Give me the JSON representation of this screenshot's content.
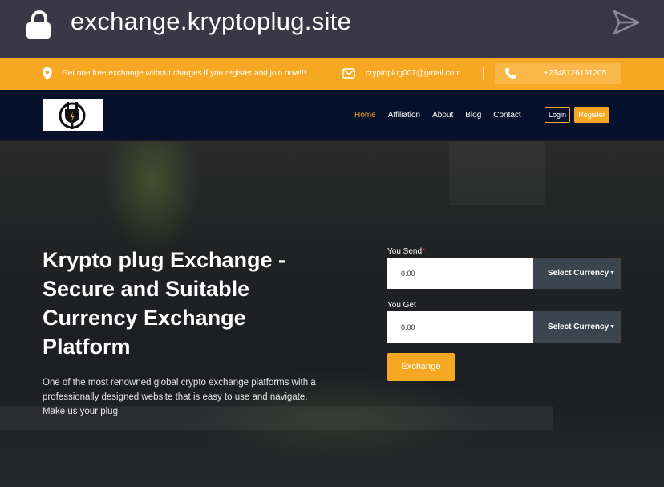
{
  "browser": {
    "url": "exchange.kryptoplug.site"
  },
  "topbar": {
    "promo": "Get one free exchange without charges if you register and join now!!!",
    "email": "cryptoplug007@gmail.com",
    "phone": "+2348126191205"
  },
  "nav": {
    "items": [
      {
        "label": "Home"
      },
      {
        "label": "Affiliation"
      },
      {
        "label": "About"
      },
      {
        "label": "Blog"
      },
      {
        "label": "Contact"
      }
    ],
    "login": "Login",
    "register": "Register"
  },
  "hero": {
    "title": "Krypto plug Exchange - Secure and Suitable Currency Exchange Platform",
    "description": "One of the most renowned global crypto exchange platforms with a professionally designed website that is easy to use and navigate. Make us your plug"
  },
  "form": {
    "send_label": "You Send",
    "required_mark": "*",
    "send_value": "0.00",
    "send_currency": "Select Currency",
    "get_label": "You Get",
    "get_value": "0.00",
    "get_currency": "Select Currency",
    "submit": "Exchange"
  },
  "colors": {
    "accent": "#f7a823",
    "navbar": "#08112c",
    "urlbar": "#3a3847"
  }
}
